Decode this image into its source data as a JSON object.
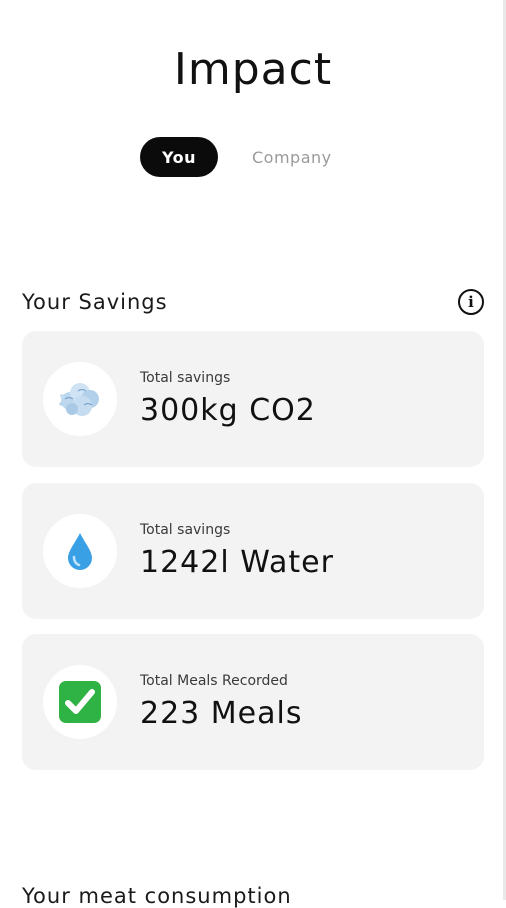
{
  "header": {
    "title": "Impact"
  },
  "toggle": {
    "options": [
      {
        "label": "You",
        "active": true
      },
      {
        "label": "Company",
        "active": false
      }
    ]
  },
  "savings": {
    "title": "Your Savings",
    "info_icon": "info-icon",
    "cards": [
      {
        "icon": "cloud-icon",
        "label": "Total savings",
        "value": "300kg CO2"
      },
      {
        "icon": "water-drop-icon",
        "label": "Total savings",
        "value": "1242l Water"
      },
      {
        "icon": "check-mark-icon",
        "label": "Total Meals Recorded",
        "value": "223 Meals"
      }
    ]
  },
  "next_section": {
    "title": "Your meat consumption"
  },
  "colors": {
    "active_toggle": "#0b0b0b",
    "card_background": "#f3f3f3",
    "check_green": "#2fb344",
    "water_blue": "#3aa0e6"
  }
}
